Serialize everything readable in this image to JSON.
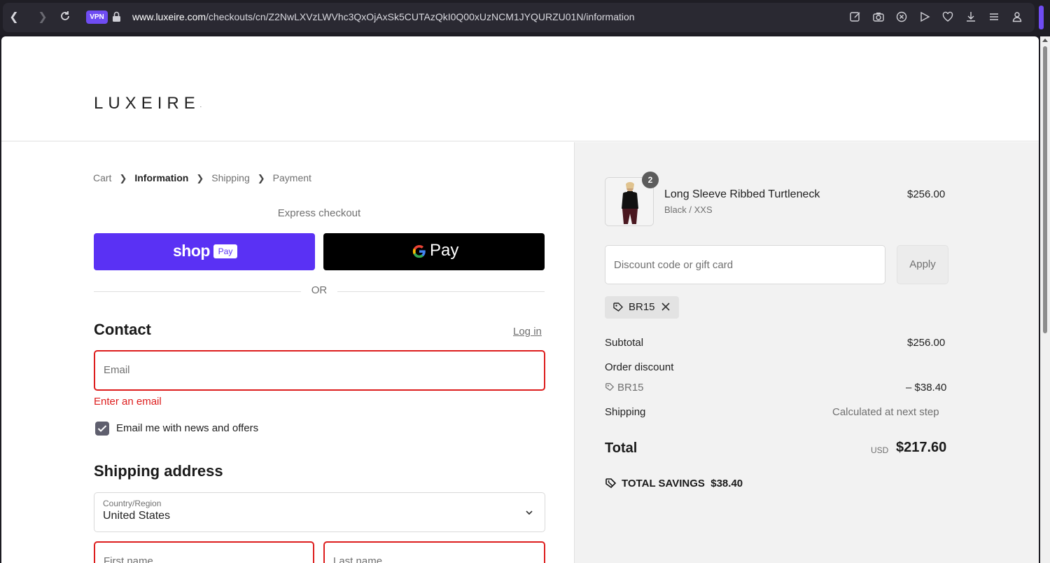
{
  "browser": {
    "vpn_label": "VPN",
    "url_domain": "www.luxeire.com",
    "url_path": "/checkouts/cn/Z2NwLXVzLWVhc3QxOjAxSk5CUTAzQkI0Q00xUzNCM1JYQURZU01N/information"
  },
  "header": {
    "logo": "LUXEIRE",
    "logo_mark": "."
  },
  "breadcrumb": {
    "items": [
      "Cart",
      "Information",
      "Shipping",
      "Payment"
    ],
    "current": "Information"
  },
  "express": {
    "title": "Express checkout",
    "shop_pay_text": "shop",
    "shop_pay_badge": "Pay",
    "gpay_text": "Pay",
    "or": "OR"
  },
  "contact": {
    "title": "Contact",
    "login": "Log in",
    "email_placeholder": "Email",
    "email_error": "Enter an email",
    "newsletter_label": "Email me with news and offers",
    "newsletter_checked": true
  },
  "shipping_address": {
    "title": "Shipping address",
    "country_label": "Country/Region",
    "country_value": "United States",
    "first_name_placeholder": "First name",
    "last_name_placeholder": "Last name"
  },
  "summary": {
    "item": {
      "name": "Long Sleeve Ribbed Turtleneck",
      "variant": "Black / XXS",
      "price": "$256.00",
      "quantity": "2"
    },
    "discount_placeholder": "Discount code or gift card",
    "apply_label": "Apply",
    "applied_code": "BR15",
    "subtotal_label": "Subtotal",
    "subtotal_value": "$256.00",
    "order_discount_label": "Order discount",
    "order_discount_code": "BR15",
    "order_discount_value": "– $38.40",
    "shipping_label": "Shipping",
    "shipping_value": "Calculated at next step",
    "total_label": "Total",
    "total_currency": "USD",
    "total_value": "$217.60",
    "savings_label": "TOTAL SAVINGS",
    "savings_value": "$38.40"
  },
  "colors": {
    "shop_pay": "#5a31f4",
    "error": "#dd1d1d",
    "accent_vpn": "#6f4cf2"
  }
}
